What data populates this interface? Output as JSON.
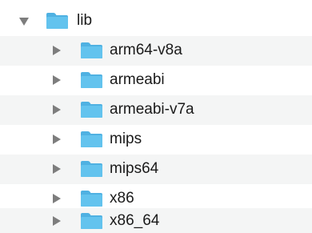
{
  "tree": {
    "root": {
      "label": "lib",
      "expanded": true,
      "icon": "folder-icon"
    },
    "children": [
      {
        "label": "arm64-v8a",
        "expanded": false,
        "icon": "folder-icon"
      },
      {
        "label": "armeabi",
        "expanded": false,
        "icon": "folder-icon"
      },
      {
        "label": "armeabi-v7a",
        "expanded": false,
        "icon": "folder-icon"
      },
      {
        "label": "mips",
        "expanded": false,
        "icon": "folder-icon"
      },
      {
        "label": "mips64",
        "expanded": false,
        "icon": "folder-icon"
      },
      {
        "label": "x86",
        "expanded": false,
        "icon": "folder-icon"
      },
      {
        "label": "x86_64",
        "expanded": false,
        "icon": "folder-icon"
      }
    ]
  },
  "colors": {
    "folder_body": "#63c3ee",
    "folder_tab": "#4fb1e2",
    "disclosure": "#7d7d7d",
    "alt_row": "#f4f5f5"
  }
}
